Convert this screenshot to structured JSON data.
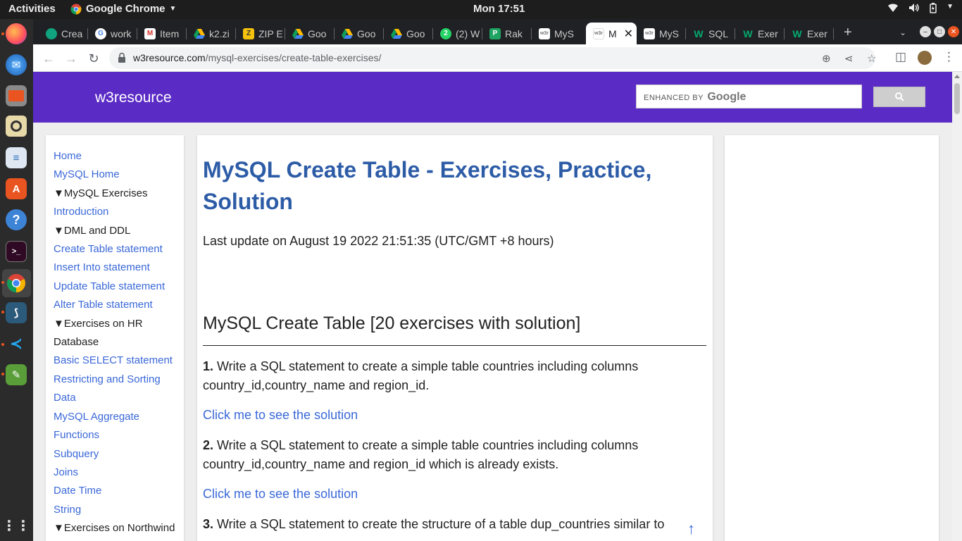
{
  "system": {
    "activities": "Activities",
    "app_menu": "Google Chrome",
    "clock": "Mon 17:51"
  },
  "dock": {
    "items": [
      "firefox-icon",
      "thunderbird-icon",
      "files-icon",
      "rhythmbox-icon",
      "libreoffice-writer-icon",
      "software-center-icon",
      "help-icon",
      "terminal-icon",
      "chrome-icon",
      "mysql-workbench-icon",
      "vscode-icon",
      "image-viewer-icon",
      "show-apps-icon"
    ]
  },
  "tabs": [
    {
      "label": "Crea",
      "fav": "chatgpt-icon",
      "color": "#10a37f"
    },
    {
      "label": "work",
      "fav": "google-icon",
      "color": "#4285f4"
    },
    {
      "label": "Item",
      "fav": "gmail-icon",
      "color": "#d93025"
    },
    {
      "label": "k2.zi",
      "fav": "drive-icon",
      "color": "#1fa463"
    },
    {
      "label": "ZIP E",
      "fav": "zip-icon",
      "color": "#f4c20d"
    },
    {
      "label": "Goo",
      "fav": "drive-icon",
      "color": "#1fa463"
    },
    {
      "label": "Goo",
      "fav": "drive-icon",
      "color": "#1fa463"
    },
    {
      "label": "Goo",
      "fav": "drive-icon",
      "color": "#1fa463"
    },
    {
      "label": "(2) W",
      "fav": "whatsapp-icon",
      "color": "#25d366"
    },
    {
      "label": "Rak",
      "fav": "rakuten-icon",
      "color": "#1fa463"
    },
    {
      "label": "MyS",
      "fav": "w3r-icon",
      "color": "#ffffff"
    },
    {
      "label": "M",
      "fav": "w3r-icon",
      "color": "#ffffff",
      "active": true
    },
    {
      "label": "MyS",
      "fav": "w3r-icon",
      "color": "#ffffff"
    },
    {
      "label": "SQL",
      "fav": "w3schools-icon",
      "color": "#04aa6d"
    },
    {
      "label": "Exer",
      "fav": "w3schools-icon",
      "color": "#04aa6d"
    },
    {
      "label": "Exer",
      "fav": "w3schools-icon",
      "color": "#04aa6d"
    }
  ],
  "toolbar": {
    "url_host": "w3resource.com",
    "url_path": "/mysql-exercises/create-table-exercises/"
  },
  "site": {
    "brand": "w3resource",
    "search_placeholder_prefix": "ENHANCED BY",
    "search_placeholder_brand": "Google",
    "header_color": "#5b2bc6"
  },
  "left_nav": [
    {
      "label": "Home",
      "type": "link"
    },
    {
      "label": "MySQL Home",
      "type": "link"
    },
    {
      "label": "▼MySQL Exercises",
      "type": "section"
    },
    {
      "label": "Introduction",
      "type": "link"
    },
    {
      "label": "▼DML and DDL",
      "type": "section"
    },
    {
      "label": "Create Table statement",
      "type": "link"
    },
    {
      "label": "Insert Into statement",
      "type": "link"
    },
    {
      "label": "Update Table statement",
      "type": "link"
    },
    {
      "label": "Alter Table statement",
      "type": "link"
    },
    {
      "label": "▼Exercises on HR",
      "type": "section"
    },
    {
      "label": "Database",
      "type": "section"
    },
    {
      "label": "Basic SELECT statement",
      "type": "link"
    },
    {
      "label": "Restricting and Sorting",
      "type": "link"
    },
    {
      "label": "Data",
      "type": "link"
    },
    {
      "label": "MySQL Aggregate",
      "type": "link"
    },
    {
      "label": "Functions",
      "type": "link"
    },
    {
      "label": "Subquery",
      "type": "link"
    },
    {
      "label": "Joins",
      "type": "link"
    },
    {
      "label": "Date Time",
      "type": "link"
    },
    {
      "label": "String",
      "type": "link"
    },
    {
      "label": "▼Exercises on Northwind",
      "type": "section"
    }
  ],
  "main": {
    "title": "MySQL Create Table - Exercises, Practice, Solution",
    "updated": "Last update on August 19 2022 21:51:35 (UTC/GMT +8 hours)",
    "section_title": "MySQL Create Table [20 exercises with solution]",
    "questions": [
      {
        "num": "1.",
        "text": " Write a SQL statement to create a simple table countries including columns country_id,country_name and region_id.",
        "solution": "Click me to see the solution"
      },
      {
        "num": "2.",
        "text": " Write a SQL statement to create a simple table countries including columns country_id,country_name and region_id which is already exists.",
        "solution": "Click me to see the solution"
      },
      {
        "num": "3.",
        "text": " Write a SQL statement to create the structure of a table dup_countries similar to",
        "solution": ""
      }
    ]
  }
}
